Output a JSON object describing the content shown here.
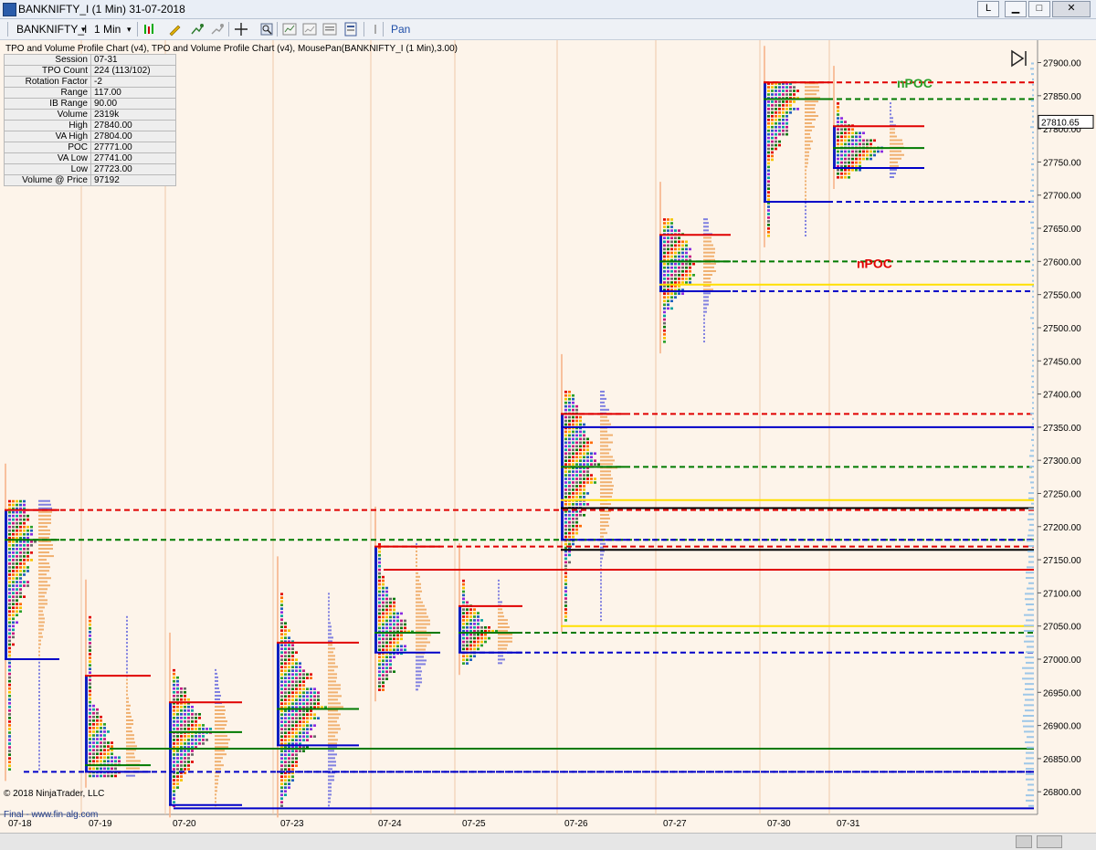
{
  "window": {
    "title": "BANKNIFTY_I (1 Min)  31-07-2018",
    "btn_l": "L",
    "btn_min": "▁",
    "btn_max": "□",
    "btn_close": "✕"
  },
  "toolbar": {
    "instrument": "BANKNIFTY_I",
    "interval": "1 Min",
    "mode": "Pan"
  },
  "chart": {
    "title": "TPO and Volume Profile Chart (v4),  TPO and Volume Profile Chart (v4), MousePan(BANKNIFTY_I (1 Min),3.00)",
    "copyright": "© 2018 NinjaTrader, LLC",
    "footer": "Final - www.fin-alg.com",
    "current_price": "27810.65",
    "npoc_labels": [
      "nPOC",
      "nPOC"
    ],
    "colors": {
      "background": "#fdf4ea",
      "red": "#e00000",
      "green": "#007a00",
      "blue": "#0000c8",
      "yellow": "#ffe000"
    }
  },
  "info": [
    {
      "k": "Session",
      "v": "07-31"
    },
    {
      "k": "TPO Count",
      "v": "224 (113/102)"
    },
    {
      "k": "Rotation Factor",
      "v": "-2"
    },
    {
      "k": "Range",
      "v": "117.00"
    },
    {
      "k": "IB Range",
      "v": "90.00"
    },
    {
      "k": "Volume",
      "v": "2319k"
    },
    {
      "k": "High",
      "v": "27840.00"
    },
    {
      "k": "VA High",
      "v": "27804.00"
    },
    {
      "k": "POC",
      "v": "27771.00"
    },
    {
      "k": "VA Low",
      "v": "27741.00"
    },
    {
      "k": "Low",
      "v": "27723.00"
    },
    {
      "k": "Volume @ Price",
      "v": "97192"
    }
  ],
  "chart_data": {
    "type": "candlestick",
    "y_axis": [
      "27900.00",
      "27850.00",
      "27800.00",
      "27750.00",
      "27700.00",
      "27650.00",
      "27600.00",
      "27550.00",
      "27500.00",
      "27450.00",
      "27400.00",
      "27350.00",
      "27300.00",
      "27250.00",
      "27200.00",
      "27150.00",
      "27100.00",
      "27050.00",
      "27000.00",
      "26950.00",
      "26900.00",
      "26850.00",
      "26800.00"
    ],
    "ylim": [
      26770,
      27920
    ],
    "x_axis": [
      "07-18",
      "07-19",
      "07-20",
      "07-23",
      "07-24",
      "07-25",
      "07-26",
      "07-27",
      "07-30",
      "07-31"
    ],
    "sessions": [
      {
        "date": "07-18",
        "low": 26830,
        "high": 27240,
        "poc": 27180,
        "vah": 27225,
        "val": 27000
      },
      {
        "date": "07-19",
        "low": 26820,
        "high": 27065,
        "poc": 26840,
        "vah": 26975,
        "val": 26830
      },
      {
        "date": "07-20",
        "low": 26775,
        "high": 26985,
        "poc": 26890,
        "vah": 26935,
        "val": 26780
      },
      {
        "date": "07-23",
        "low": 26775,
        "high": 27100,
        "poc": 26925,
        "vah": 27025,
        "val": 26870
      },
      {
        "date": "07-24",
        "low": 26950,
        "high": 27175,
        "poc": 27040,
        "vah": 27170,
        "val": 27010
      },
      {
        "date": "07-25",
        "low": 26990,
        "high": 27120,
        "poc": 27040,
        "vah": 27080,
        "val": 27010
      },
      {
        "date": "07-26",
        "low": 27055,
        "high": 27405,
        "poc": 27290,
        "vah": 27370,
        "val": 27180
      },
      {
        "date": "07-27",
        "low": 27475,
        "high": 27665,
        "poc": 27600,
        "vah": 27640,
        "val": 27555
      },
      {
        "date": "07-30",
        "low": 27635,
        "high": 27870,
        "poc": 27845,
        "vah": 27870,
        "val": 27690
      },
      {
        "date": "07-31",
        "low": 27723,
        "high": 27840,
        "poc": 27771,
        "vah": 27804,
        "val": 27741
      }
    ],
    "current_price": 27810.65
  }
}
